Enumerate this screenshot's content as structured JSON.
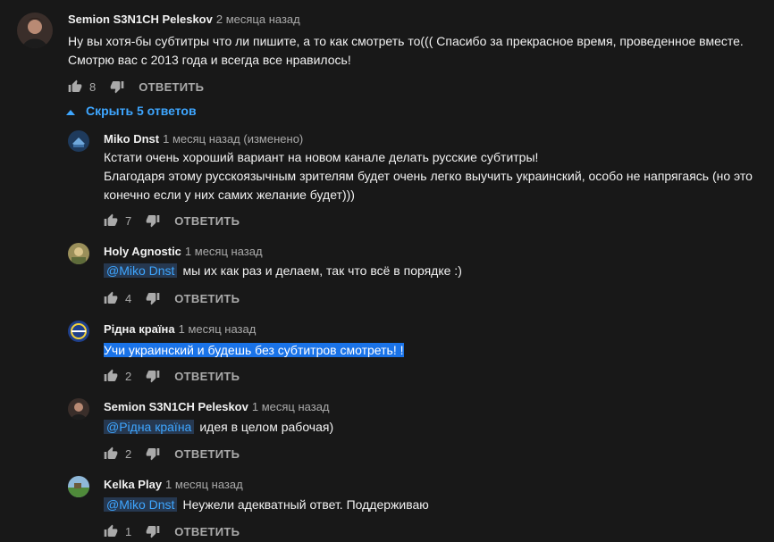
{
  "comments": [
    {
      "author": "Semion S3N1CH Peleskov",
      "time": "2 месяца назад",
      "lines": [
        "Ну вы хотя-бы субтитры что ли пишите, а то как смотреть то((( Спасибо за прекрасное время, проведенное вместе.",
        "Смотрю вас с 2013 года и всегда все нравилось!"
      ],
      "likes": "8",
      "reply_label": "ОТВЕТИТЬ"
    }
  ],
  "replies_toggle": {
    "label": "Скрыть 5 ответов"
  },
  "replies": [
    {
      "author": "Miko Dnst",
      "time": "1 месяц назад (изменено)",
      "lines": [
        "Кстати очень хороший вариант на новом канале делать русские субтитры!",
        "Благодаря этому русскоязычным зрителям будет очень легко выучить украинский, особо не напрягаясь (но это",
        "конечно если у них самих желание будет)))"
      ],
      "likes": "7",
      "reply_label": "ОТВЕТИТЬ"
    },
    {
      "author": "Holy Agnostic",
      "time": "1 месяц назад",
      "mention": "@Miko Dnst",
      "text": "мы их как раз и делаем, так что всё в порядке :)",
      "likes": "4",
      "reply_label": "ОТВЕТИТЬ"
    },
    {
      "author": "Рідна країна",
      "time": "1 месяц назад",
      "text": "Учи украинский и будешь без субтитров смотреть! !",
      "likes": "2",
      "reply_label": "ОТВЕТИТЬ"
    },
    {
      "author": "Semion S3N1CH Peleskov",
      "time": "1 месяц назад",
      "mention": "@Рідна країна",
      "text": "идея в целом рабочая)",
      "likes": "2",
      "reply_label": "ОТВЕТИТЬ"
    },
    {
      "author": "Kelka Play",
      "time": "1 месяц назад",
      "mention": "@Miko Dnst",
      "text": "Неужели адекватный ответ. Поддерживаю",
      "likes": "1",
      "reply_label": "ОТВЕТИТЬ"
    }
  ],
  "colors": {
    "background": "#181818",
    "link": "#3ea6ff",
    "muted": "#aaaaaa",
    "selection": "#1a73e8"
  },
  "icons": [
    "like-icon",
    "dislike-icon",
    "caret-up-icon"
  ]
}
